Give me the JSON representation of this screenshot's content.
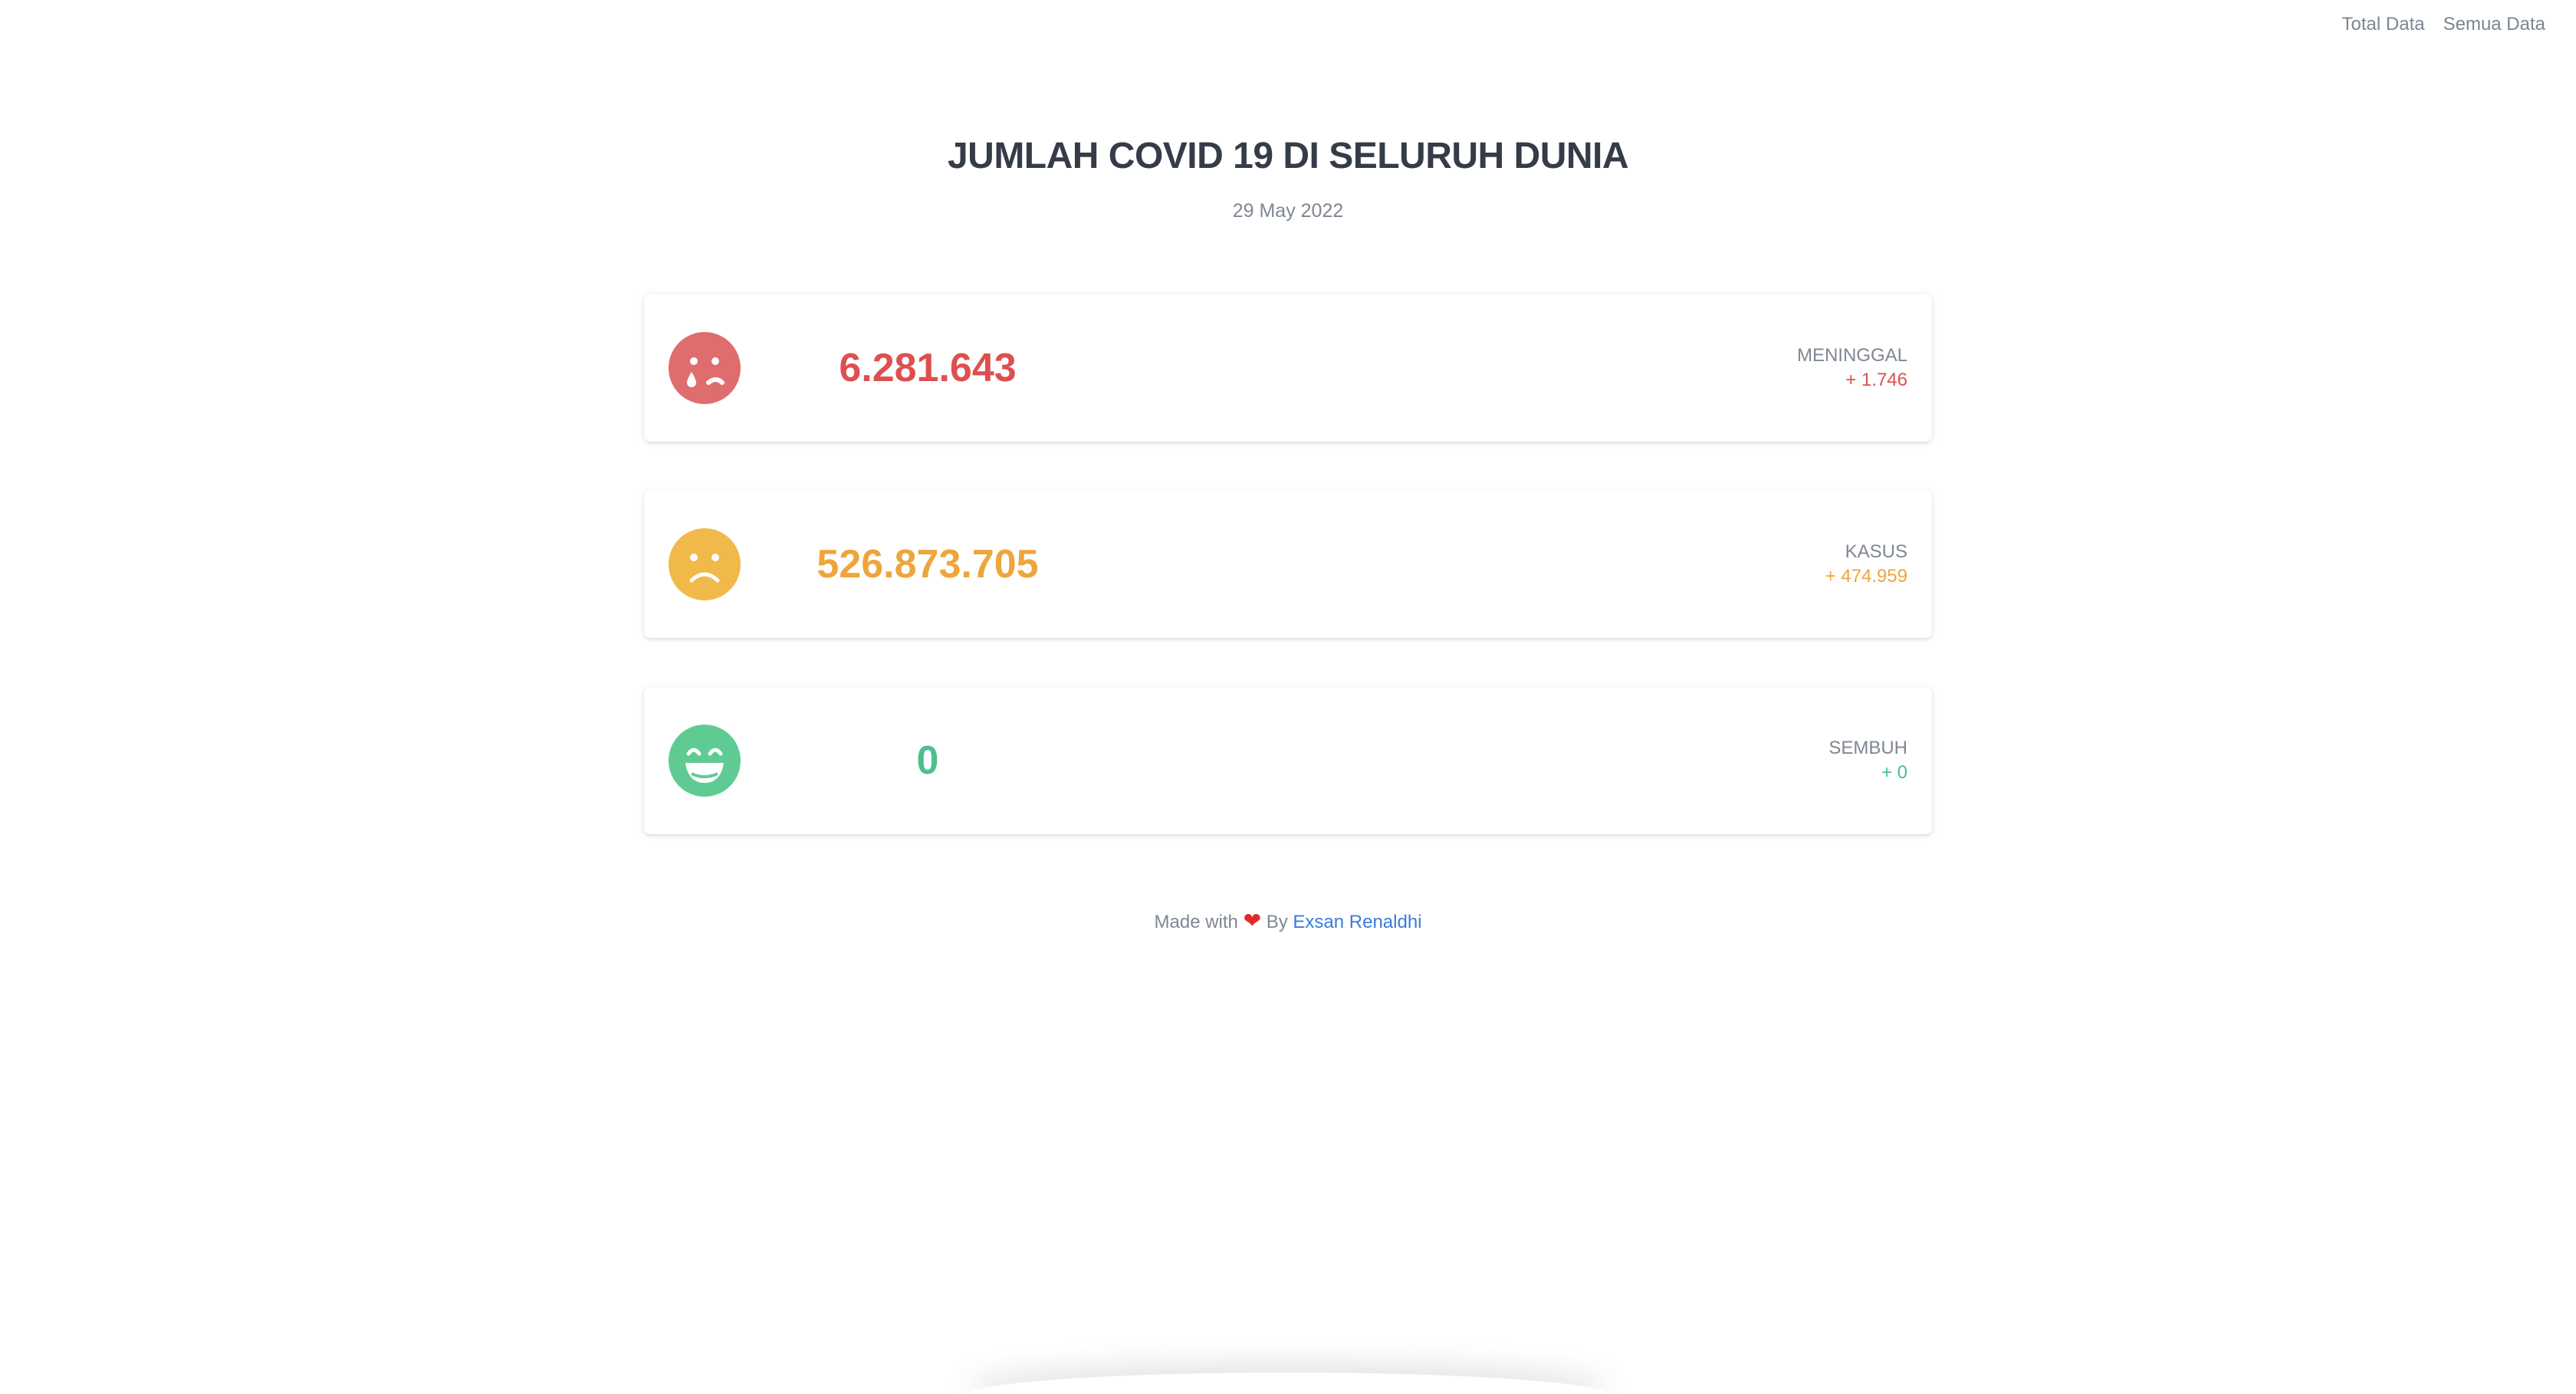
{
  "nav": {
    "items": [
      "Total Data",
      "Semua Data"
    ]
  },
  "header": {
    "title": "JUMLAH COVID 19 DI SELURUH DUNIA",
    "date": "29 May 2022"
  },
  "cards": [
    {
      "icon": "sad-tear-icon",
      "value": "6.281.643",
      "label": "MENINGGAL",
      "delta": "+ 1.746",
      "color": "#de4f4f"
    },
    {
      "icon": "frown-icon",
      "value": "526.873.705",
      "label": "KASUS",
      "delta": "+ 474.959",
      "color": "#eea53c"
    },
    {
      "icon": "grin-icon",
      "value": "0",
      "label": "SEMBUH",
      "delta": "+ 0",
      "color": "#4dbf8a"
    }
  ],
  "footer": {
    "prefix": "Made with",
    "heart": "❤",
    "by": "By",
    "author": "Exsan Renaldhi"
  }
}
